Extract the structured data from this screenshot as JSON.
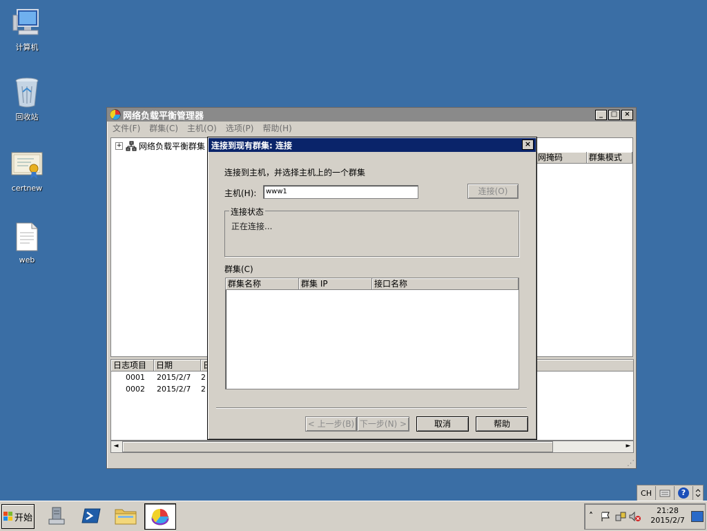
{
  "desktop": {
    "icons": [
      {
        "label": "计算机",
        "icon": "computer-icon"
      },
      {
        "label": "回收站",
        "icon": "recycle-bin-icon"
      },
      {
        "label": "certnew",
        "icon": "certificate-icon"
      },
      {
        "label": "web",
        "icon": "document-icon"
      }
    ]
  },
  "main_window": {
    "title": "网络负载平衡管理器",
    "controls": {
      "minimize": "_",
      "maximize": "□",
      "close": "×"
    },
    "menu": [
      "文件(F)",
      "群集(C)",
      "主机(O)",
      "选项(P)",
      "帮助(H)"
    ],
    "tree_root": "网络负载平衡群集",
    "tree_expander": "+",
    "right_headers": [
      "网掩码",
      "群集模式"
    ],
    "log_headers": [
      "日志项目",
      "日期",
      "日"
    ],
    "log_rows": [
      {
        "id": "0001",
        "date": "2015/2/7",
        "extra": "2"
      },
      {
        "id": "0002",
        "date": "2015/2/7",
        "extra": "2"
      }
    ],
    "scroll_left": "◄",
    "scroll_right": "►",
    "resize_grip": "⋰"
  },
  "dialog": {
    "title": "连接到现有群集:  连接",
    "close": "×",
    "instruction": "连接到主机，并选择主机上的一个群集",
    "host_label": "主机(H):",
    "host_value": "www1",
    "connect_button": "连接(O)",
    "status_group": "连接状态",
    "status_text": "正在连接...",
    "clusters_label": "群集(C)",
    "columns": [
      "群集名称",
      "群集 IP",
      "接口名称"
    ],
    "back_button": "< 上一步(B)",
    "next_button": "下一步(N) >",
    "cancel_button": "取消",
    "help_button": "帮助"
  },
  "taskbar": {
    "start_label": "开始",
    "apps": [
      "server-manager-icon",
      "powershell-icon",
      "explorer-icon",
      "nlb-manager-icon"
    ],
    "lang": "CH",
    "help_symbol": "?",
    "tray_chevron": "˄",
    "time": "21:28",
    "date": "2015/2/7"
  },
  "colors": {
    "desktop": "#3a6ea5",
    "dialog_title": "#0a246a",
    "inactive_title": "#8a8a8a",
    "face": "#d4d0c8"
  }
}
